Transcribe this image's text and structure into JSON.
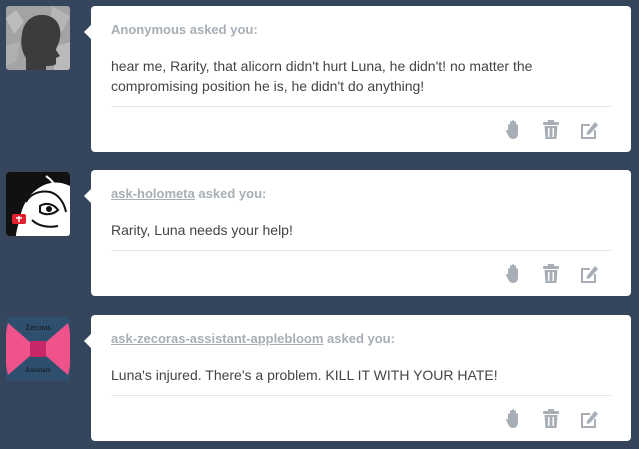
{
  "colors": {
    "background": "#35465c",
    "card": "#ffffff",
    "header_text": "#a7aeb6",
    "question_text": "#444444",
    "icon": "#a7aeb6"
  },
  "asks": [
    {
      "asker": "Anonymous",
      "asked_suffix": " asked you:",
      "question": "hear me, Rarity, that alicorn didn't hurt Luna, he didn't! no matter the compromising position he is, he didn't do anything!",
      "avatar": "anonymous-silhouette-avatar",
      "actions": [
        "block-icon",
        "delete-icon",
        "edit-icon"
      ]
    },
    {
      "asker": "ask-holometa",
      "asked_suffix": " asked you:",
      "question": "Rarity, Luna needs your help!",
      "avatar": "holometa-avatar",
      "actions": [
        "block-icon",
        "delete-icon",
        "edit-icon"
      ]
    },
    {
      "asker": "ask-zecoras-assistant-applebloom",
      "asked_suffix": " asked you:",
      "question": "Luna's injured. There's a problem. KILL IT WITH YOUR HATE!",
      "avatar": "zecoras-assistant-bow-avatar",
      "avatar_text_top": "Zecoras",
      "avatar_text_bottom": "Assistant",
      "actions": [
        "block-icon",
        "delete-icon",
        "edit-icon"
      ]
    }
  ]
}
